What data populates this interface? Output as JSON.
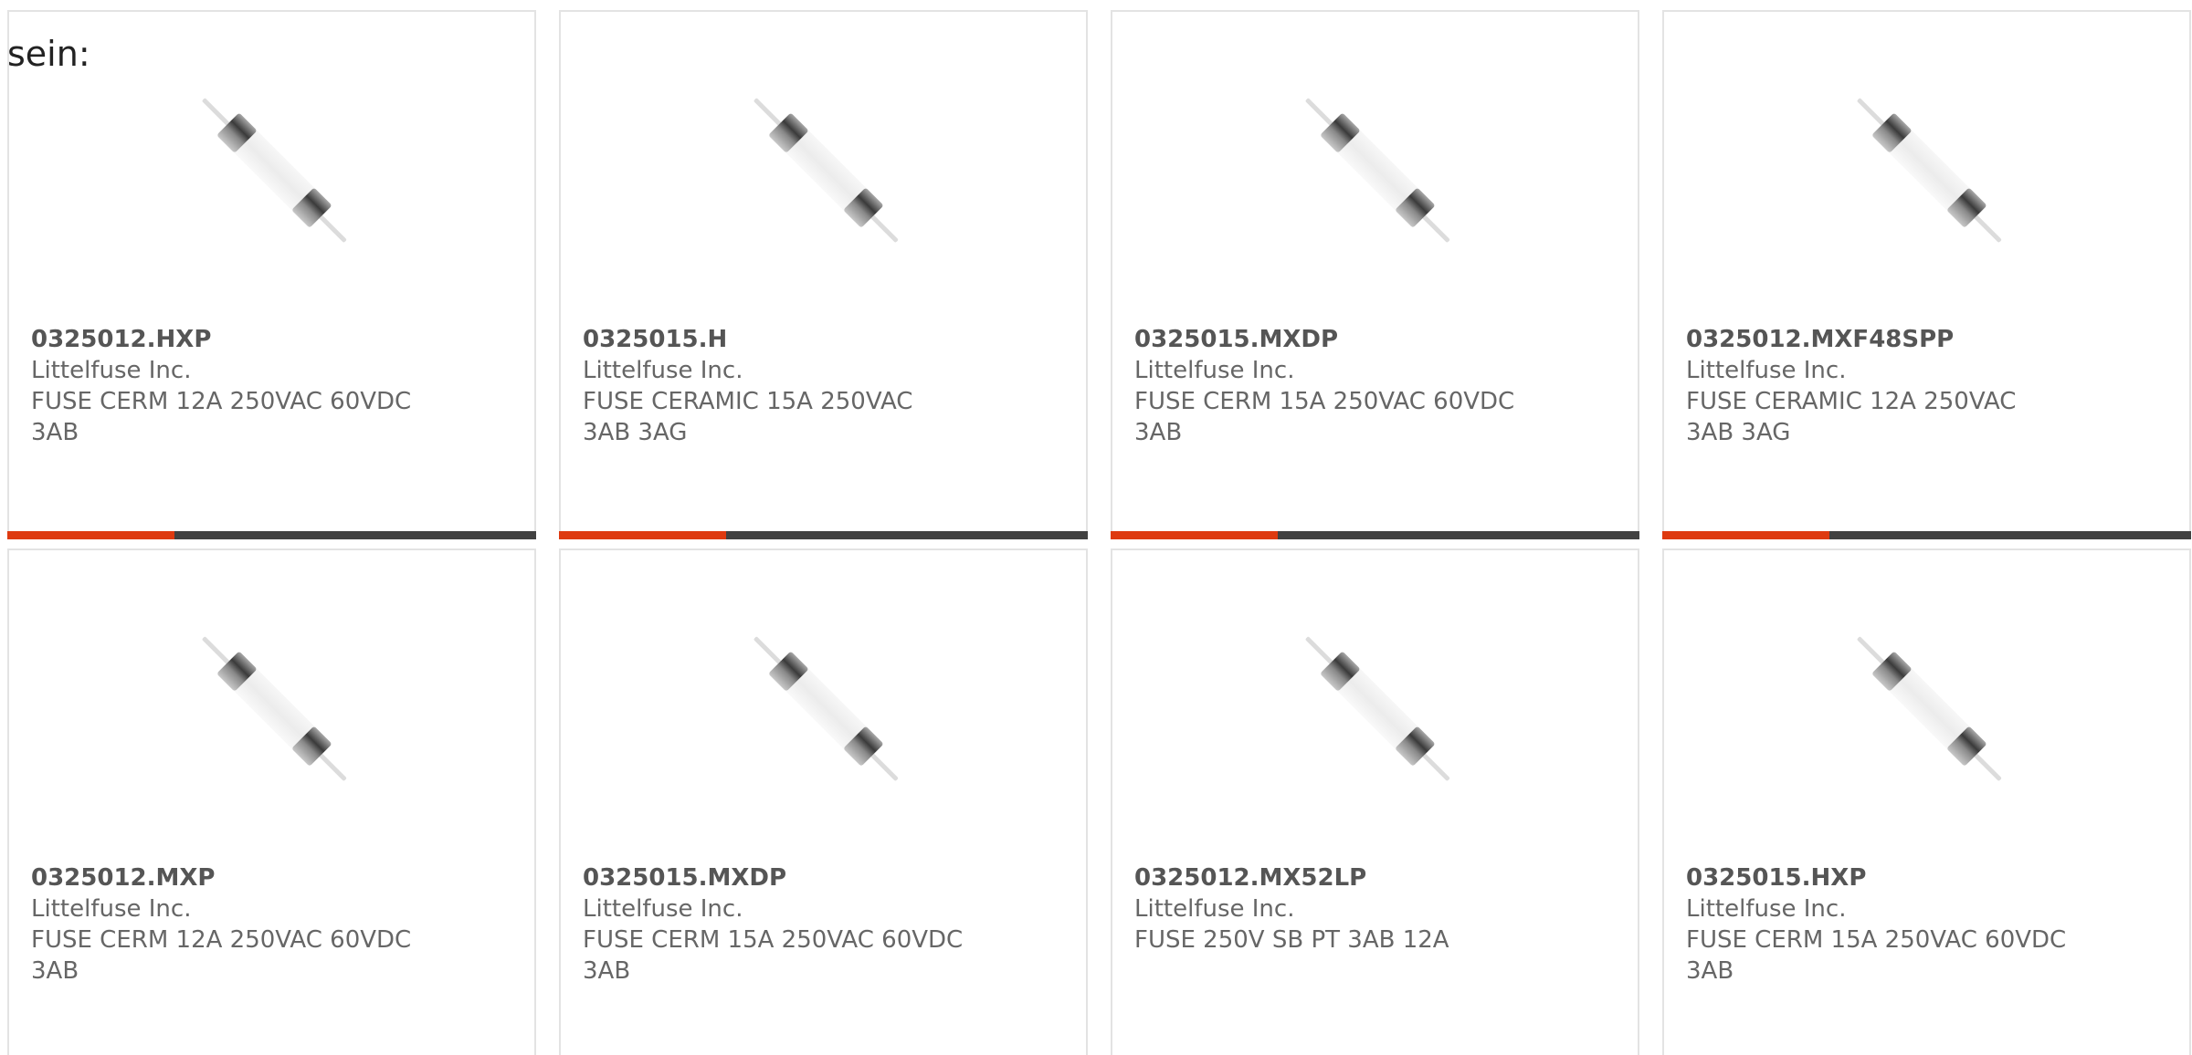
{
  "intro": {
    "text": "sein:"
  },
  "colors": {
    "accent": "#de3a10",
    "bar": "#414141",
    "border": "#e3e3e3",
    "text": "#666666"
  },
  "products": [
    {
      "part_number": "0325012.HXP",
      "manufacturer": "Littelfuse Inc.",
      "description": "FUSE CERM 12A 250VAC 60VDC 3AB",
      "image": "cartridge-fuse-icon"
    },
    {
      "part_number": "0325015.H",
      "manufacturer": "Littelfuse Inc.",
      "description": "FUSE CERAMIC 15A 250VAC 3AB 3AG",
      "image": "cartridge-fuse-icon"
    },
    {
      "part_number": "0325015.MXDP",
      "manufacturer": "Littelfuse Inc.",
      "description": "FUSE CERM 15A 250VAC 60VDC 3AB",
      "image": "cartridge-fuse-icon"
    },
    {
      "part_number": "0325012.MXF48SPP",
      "manufacturer": "Littelfuse Inc.",
      "description": "FUSE CERAMIC 12A 250VAC 3AB 3AG",
      "image": "cartridge-fuse-icon"
    },
    {
      "part_number": "0325012.MXP",
      "manufacturer": "Littelfuse Inc.",
      "description": "FUSE CERM 12A 250VAC 60VDC 3AB",
      "image": "cartridge-fuse-icon"
    },
    {
      "part_number": "0325015.MXDP",
      "manufacturer": "Littelfuse Inc.",
      "description": "FUSE CERM 15A 250VAC 60VDC 3AB",
      "image": "cartridge-fuse-icon"
    },
    {
      "part_number": "0325012.MX52LP",
      "manufacturer": "Littelfuse Inc.",
      "description": "FUSE 250V SB PT 3AB 12A",
      "image": "cartridge-fuse-icon"
    },
    {
      "part_number": "0325015.HXP",
      "manufacturer": "Littelfuse Inc.",
      "description": "FUSE CERM 15A 250VAC 60VDC 3AB",
      "image": "cartridge-fuse-icon"
    }
  ]
}
